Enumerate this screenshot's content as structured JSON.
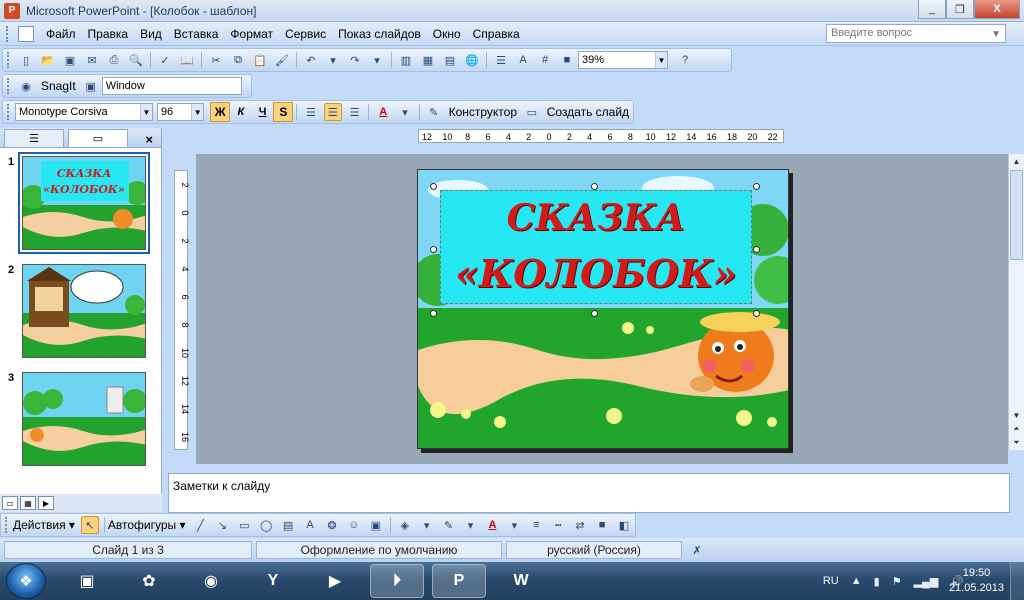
{
  "window": {
    "title": "Microsoft PowerPoint - [Колобок - шаблон]",
    "app_icon": "powerpoint-icon",
    "min_label": "_",
    "restore_label": "❐",
    "close_label": "X"
  },
  "menu": {
    "items": [
      "Файл",
      "Правка",
      "Вид",
      "Вставка",
      "Формат",
      "Сервис",
      "Показ слайдов",
      "Окно",
      "Справка"
    ],
    "help_placeholder": "Введите вопрос"
  },
  "standard_toolbar": {
    "zoom": "39%"
  },
  "snagit_toolbar": {
    "snagit_label": "SnagIt",
    "capture_mode": "Window"
  },
  "format_toolbar": {
    "font": "Monotype Corsiva",
    "size": "96",
    "bold": "Ж",
    "italic": "К",
    "underline": "Ч",
    "shadow": "S",
    "design_label": "Конструктор",
    "new_slide_label": "Создать слайд"
  },
  "left_pane": {
    "close": "×",
    "slides": [
      "1",
      "2",
      "3"
    ]
  },
  "slide": {
    "title_line1": "СКАЗКА",
    "title_line2": "«КОЛОБОК»"
  },
  "thumbnail_1": {
    "line1": "СКАЗКА",
    "line2": "«КОЛОБОК»"
  },
  "ruler": {
    "h_ticks": [
      "12",
      "10",
      "8",
      "6",
      "4",
      "2",
      "0",
      "2",
      "4",
      "6",
      "8",
      "10",
      "12",
      "14",
      "16",
      "18",
      "20",
      "22"
    ],
    "v_ticks": [
      "2",
      "0",
      "2",
      "4",
      "6",
      "8",
      "10",
      "12",
      "14",
      "16"
    ]
  },
  "notes": {
    "placeholder": "Заметки к слайду"
  },
  "draw_toolbar": {
    "actions_label": "Действия ▾",
    "autoshapes_label": "Автофигуры ▾"
  },
  "status": {
    "slide": "Слайд 1 из 3",
    "design": "Оформление по умолчанию",
    "language": "русский (Россия)"
  },
  "taskbar": {
    "lang": "RU",
    "time": "19:50",
    "date": "21.05.2013"
  }
}
